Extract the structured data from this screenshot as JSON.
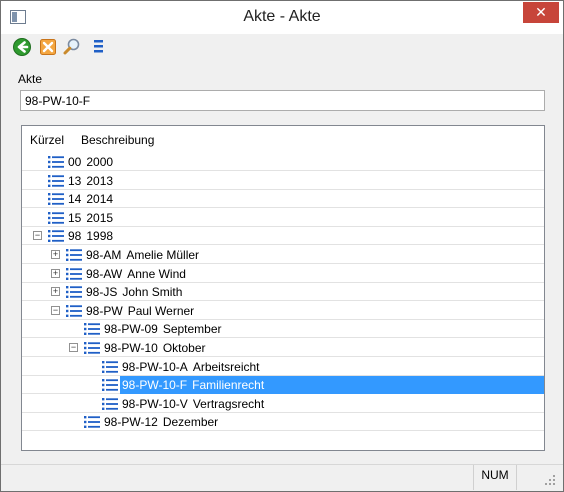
{
  "window": {
    "title": "Akte - Akte",
    "close_glyph": "✕"
  },
  "toolbar": {
    "icons": [
      "back-arrow-icon",
      "delete-icon",
      "search-icon",
      "list-icon"
    ]
  },
  "akte": {
    "label": "Akte",
    "value": "98-PW-10-F"
  },
  "tree": {
    "columns": {
      "kuerzel": "Kürzel",
      "beschreibung": "Beschreibung"
    },
    "rows": [
      {
        "code": "00",
        "desc": "2000",
        "level": 0,
        "expander": ""
      },
      {
        "code": "13",
        "desc": "2013",
        "level": 0,
        "expander": ""
      },
      {
        "code": "14",
        "desc": "2014",
        "level": 0,
        "expander": ""
      },
      {
        "code": "15",
        "desc": "2015",
        "level": 0,
        "expander": ""
      },
      {
        "code": "98",
        "desc": "1998",
        "level": 0,
        "expander": "−"
      },
      {
        "code": "98-AM",
        "desc": "Amelie Müller",
        "level": 1,
        "expander": "+"
      },
      {
        "code": "98-AW",
        "desc": "Anne Wind",
        "level": 1,
        "expander": "+"
      },
      {
        "code": "98-JS",
        "desc": "John Smith",
        "level": 1,
        "expander": "+"
      },
      {
        "code": "98-PW",
        "desc": "Paul Werner",
        "level": 1,
        "expander": "−"
      },
      {
        "code": "98-PW-09",
        "desc": "September",
        "level": 2,
        "expander": ""
      },
      {
        "code": "98-PW-10",
        "desc": "Oktober",
        "level": 2,
        "expander": "−"
      },
      {
        "code": "98-PW-10-A",
        "desc": "Arbeitsreicht",
        "level": 3,
        "expander": ""
      },
      {
        "code": "98-PW-10-F",
        "desc": "Familienrecht",
        "level": 3,
        "expander": "",
        "selected": true
      },
      {
        "code": "98-PW-10-V",
        "desc": "Vertragsrecht",
        "level": 3,
        "expander": ""
      },
      {
        "code": "98-PW-12",
        "desc": "Dezember",
        "level": 2,
        "expander": ""
      }
    ]
  },
  "status": {
    "num": "NUM"
  },
  "colors": {
    "selection": "#3399ff",
    "close": "#c7453a",
    "icon_blue": "#1f5fc6"
  }
}
